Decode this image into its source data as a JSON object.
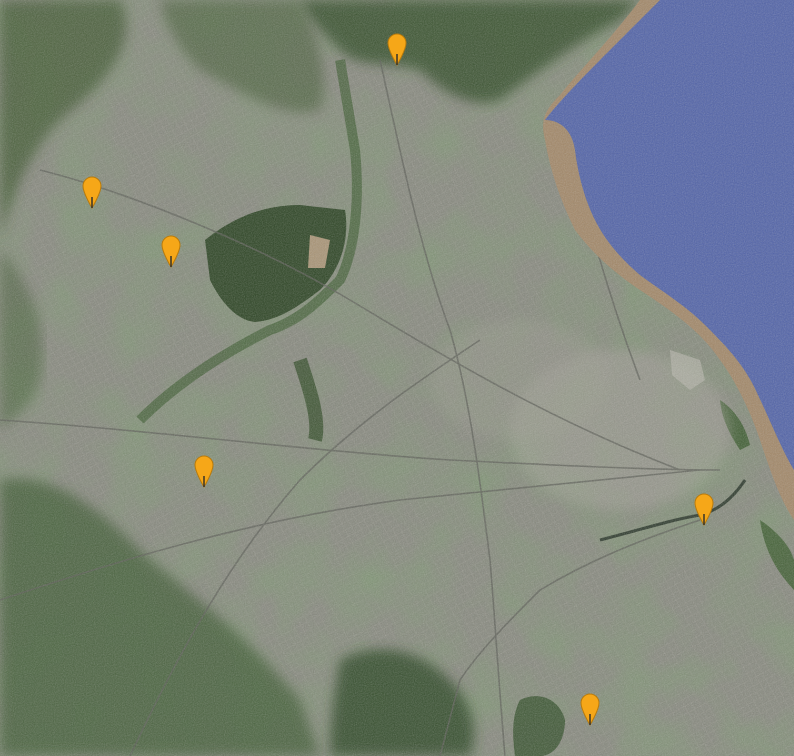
{
  "map": {
    "view": "satellite",
    "colors": {
      "urban": "#8a8b80",
      "urban_dense": "#a6a49a",
      "vegetation": "#3f5a31",
      "forest": "#2b4222",
      "water": "#4f63a9",
      "shore": "#a18667",
      "marker": "#f6a718",
      "marker_stroke": "#b87a0c"
    },
    "markers": [
      {
        "id": "marker-1",
        "icon": "map-pin-icon"
      },
      {
        "id": "marker-2",
        "icon": "map-pin-icon"
      },
      {
        "id": "marker-3",
        "icon": "map-pin-icon"
      },
      {
        "id": "marker-4",
        "icon": "map-pin-icon"
      },
      {
        "id": "marker-5",
        "icon": "map-pin-icon"
      },
      {
        "id": "marker-6",
        "icon": "map-pin-icon"
      }
    ]
  }
}
